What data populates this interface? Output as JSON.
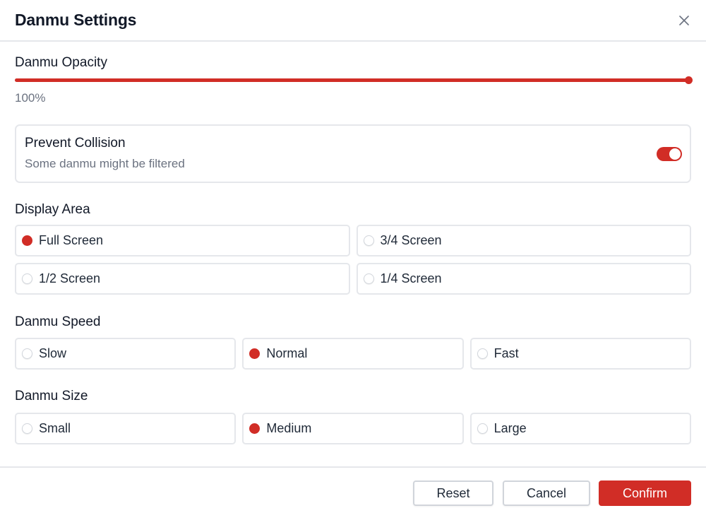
{
  "dialog": {
    "title": "Danmu Settings",
    "close_icon": "close-icon"
  },
  "opacity": {
    "label": "Danmu Opacity",
    "value_percent": 100,
    "value_text": "100%"
  },
  "collision": {
    "title": "Prevent Collision",
    "description": "Some danmu might be filtered",
    "enabled": true
  },
  "display_area": {
    "label": "Display Area",
    "options": [
      {
        "label": "Full Screen",
        "checked": true
      },
      {
        "label": "3/4 Screen",
        "checked": false
      },
      {
        "label": "1/2 Screen",
        "checked": false
      },
      {
        "label": "1/4 Screen",
        "checked": false
      }
    ]
  },
  "speed": {
    "label": "Danmu Speed",
    "options": [
      {
        "label": "Slow",
        "checked": false
      },
      {
        "label": "Normal",
        "checked": true
      },
      {
        "label": "Fast",
        "checked": false
      }
    ]
  },
  "size": {
    "label": "Danmu Size",
    "options": [
      {
        "label": "Small",
        "checked": false
      },
      {
        "label": "Medium",
        "checked": true
      },
      {
        "label": "Large",
        "checked": false
      }
    ]
  },
  "footer": {
    "reset_label": "Reset",
    "cancel_label": "Cancel",
    "confirm_label": "Confirm"
  },
  "colors": {
    "accent": "#d12d26",
    "border": "#e5e7eb",
    "muted_text": "#6b7280"
  }
}
